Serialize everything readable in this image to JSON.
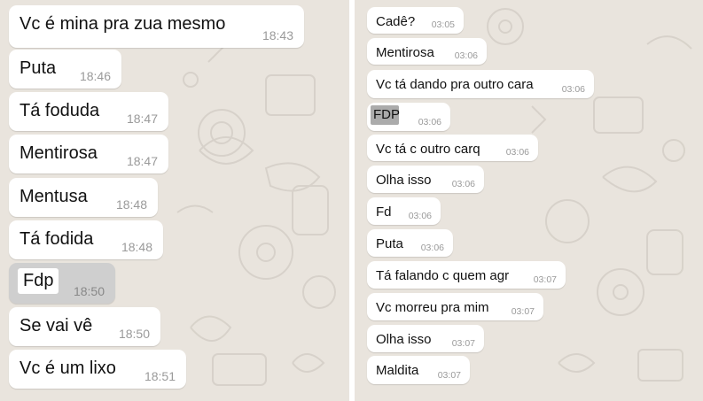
{
  "left_chat": {
    "messages": [
      {
        "text": "Vc é mina pra zua mesmo",
        "time": "18:43"
      },
      {
        "text": "Puta",
        "time": "18:46"
      },
      {
        "text": "Tá foduda",
        "time": "18:47"
      },
      {
        "text": "Mentirosa",
        "time": "18:47"
      },
      {
        "text": "Mentusa",
        "time": "18:48"
      },
      {
        "text": "Tá fodida",
        "time": "18:48"
      },
      {
        "text": "Fdp",
        "time": "18:50"
      },
      {
        "text": "Se vai vê",
        "time": "18:50"
      },
      {
        "text": "Vc é um lixo",
        "time": "18:51"
      }
    ]
  },
  "right_chat": {
    "messages": [
      {
        "text": "Cadê?",
        "time": "03:05"
      },
      {
        "text": "Mentirosa",
        "time": "03:06"
      },
      {
        "text": "Vc tá dando pra outro cara",
        "time": "03:06"
      },
      {
        "text": "FDP",
        "time": "03:06"
      },
      {
        "text": "Vc tá c outro carq",
        "time": "03:06"
      },
      {
        "text": "Olha isso",
        "time": "03:06"
      },
      {
        "text": "Fd",
        "time": "03:06"
      },
      {
        "text": "Puta",
        "time": "03:06"
      },
      {
        "text": "Tá falando c quem agr",
        "time": "03:07"
      },
      {
        "text": "Vc morreu pra mim",
        "time": "03:07"
      },
      {
        "text": "Olha isso",
        "time": "03:07"
      },
      {
        "text": "Maldita",
        "time": "03:07"
      }
    ]
  },
  "colors": {
    "chat_bg": "#e9e4dd",
    "bubble": "#ffffff",
    "time": "#9a9a9a",
    "highlight": "#ababab"
  }
}
